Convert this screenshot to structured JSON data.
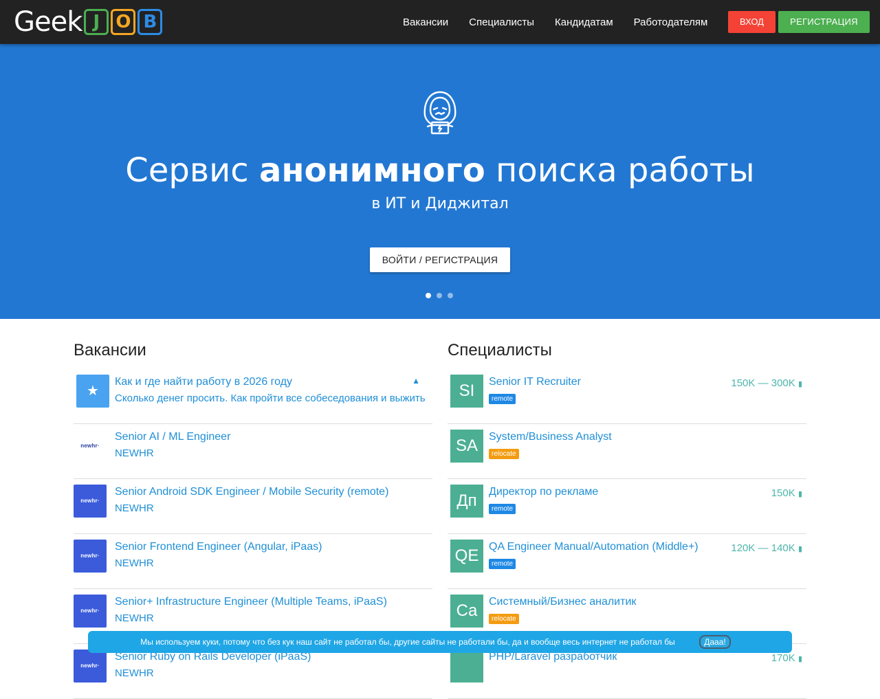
{
  "header": {
    "logo_text": "Geek",
    "logo_letters": [
      {
        "char": "J",
        "color": "#4caf50"
      },
      {
        "char": "O",
        "color": "#f5a623"
      },
      {
        "char": "B",
        "color": "#2d8ce6"
      }
    ],
    "nav": [
      "Вакансии",
      "Специалисты",
      "Кандидатам",
      "Работодателям"
    ],
    "login_label": "ВХОД",
    "register_label": "РЕГИСТРАЦИЯ"
  },
  "hero": {
    "title_pre": "Сервис ",
    "title_bold": "анонимного",
    "title_post": " поиска работы",
    "subtitle": "в ИТ и Диджитал",
    "button_label": "ВОЙТИ / РЕГИСТРАЦИЯ",
    "slides_count": 3,
    "active_slide": 1
  },
  "vacancies": {
    "title": "Вакансии",
    "items": [
      {
        "title": "Как и где найти работу в 2026 году",
        "sub": "Сколько денег просить. Как пройти все собеседования и выжить",
        "logo": "promo",
        "pinned": true
      },
      {
        "title": "Senior AI / ML Engineer",
        "sub": "NEWHR",
        "logo": "newhr-white"
      },
      {
        "title": "Senior Android SDK Engineer / Mobile Security (remote)",
        "sub": "NEWHR",
        "logo": "newhr"
      },
      {
        "title": "Senior Frontend Engineer (Angular, iPaas)",
        "sub": "NEWHR",
        "logo": "newhr"
      },
      {
        "title": "Senior+ Infrastructure Engineer (Multiple Teams, iPaaS)",
        "sub": "NEWHR",
        "logo": "newhr"
      },
      {
        "title": "Senior Ruby on Rails Developer (iPaaS)",
        "sub": "NEWHR",
        "logo": "newhr"
      }
    ],
    "logo_text": "newhr·"
  },
  "specialists": {
    "title": "Специалисты",
    "items": [
      {
        "initials": "SI",
        "title": "Senior IT Recruiter",
        "tag": "remote",
        "salary": "150K — 300K"
      },
      {
        "initials": "SA",
        "title": "System/Business Analyst",
        "tag": "relocate",
        "salary": ""
      },
      {
        "initials": "Дп",
        "title": "Директор по рекламе",
        "tag": "remote",
        "salary": "150K"
      },
      {
        "initials": "QE",
        "title": "QA Engineer Manual/Automation (Middle+)",
        "tag": "remote",
        "salary": "120K — 140K"
      },
      {
        "initials": "Ca",
        "title": "Системный/Бизнес аналитик",
        "tag": "relocate",
        "salary": ""
      },
      {
        "initials": "",
        "title": "PHP/Laravel разработчик",
        "tag": "",
        "salary": "170K"
      }
    ]
  },
  "cookie": {
    "text": "Мы используем куки, потому что без кук наш сайт не работал бы, другие сайты не работали бы, да и вообще весь интернет не работал бы",
    "button": "Дааа!"
  },
  "colors": {
    "header_bg": "#222222",
    "hero_bg": "#2277d2",
    "login": "#f44336",
    "register": "#4caf50",
    "link": "#1f8fd6",
    "salary": "#4db6ac",
    "avatar": "#4caf93",
    "cookie_bg": "#1fa6e6"
  },
  "icons": [
    "hacker-icon",
    "pin-icon",
    "wallet-icon",
    "promo-icon"
  ]
}
